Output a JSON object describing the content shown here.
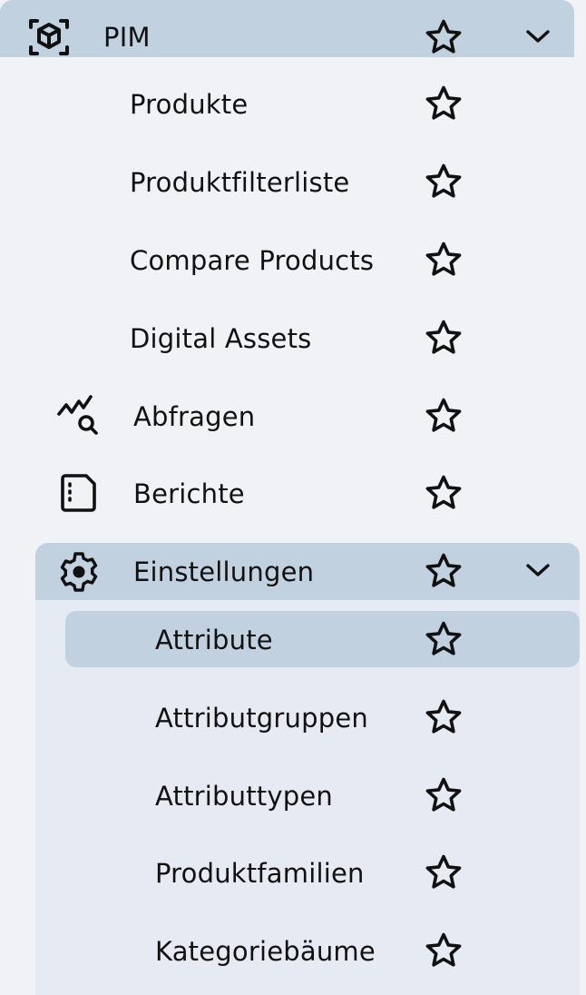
{
  "menu": {
    "pim": {
      "label": "PIM",
      "icon": "cube-scan-icon",
      "expanded": true
    },
    "items": [
      {
        "label": "Produkte"
      },
      {
        "label": "Produktfilterliste"
      },
      {
        "label": "Compare Products"
      },
      {
        "label": "Digital Assets"
      },
      {
        "label": "Abfragen",
        "icon": "chart-search-icon"
      },
      {
        "label": "Berichte",
        "icon": "report-file-icon"
      }
    ],
    "settings": {
      "label": "Einstellungen",
      "icon": "gear-icon",
      "expanded": true,
      "items": [
        {
          "label": "Attribute",
          "selected": true
        },
        {
          "label": "Attributgruppen"
        },
        {
          "label": "Attributtypen"
        },
        {
          "label": "Produktfamilien"
        },
        {
          "label": "Kategoriebäume"
        }
      ]
    }
  },
  "colors": {
    "background": "#f0f2f6",
    "header_bg": "#c2d1e0",
    "group_bg": "#e6eaf2",
    "selected_bg": "#c2d1e0",
    "text": "#111111"
  }
}
